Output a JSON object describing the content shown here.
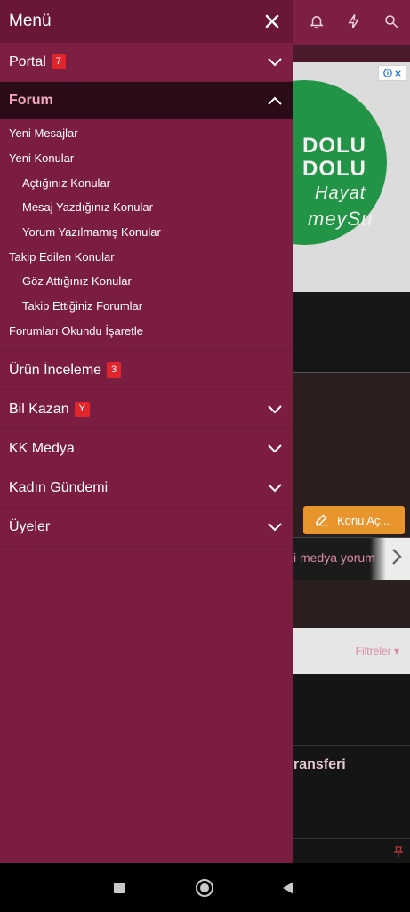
{
  "drawer": {
    "title": "Menü",
    "items": [
      {
        "label": "Portal",
        "badge": "7",
        "expanded": false
      },
      {
        "label": "Forum",
        "badge": "",
        "expanded": true
      },
      {
        "label": "Ürün İnceleme",
        "badge": "3"
      },
      {
        "label": "Bil Kazan",
        "badge": "Y",
        "expanded": false
      },
      {
        "label": "KK Medya",
        "expanded": false
      },
      {
        "label": "Kadın Gündemi",
        "expanded": false
      },
      {
        "label": "Üyeler",
        "expanded": false
      }
    ],
    "forum_sub": [
      {
        "label": "Yeni Mesajlar"
      },
      {
        "label": "Yeni Konular"
      },
      {
        "label": "Açtığınız Konular"
      },
      {
        "label": "Mesaj Yazdığınız Konular"
      },
      {
        "label": "Yorum Yazılmamış Konular"
      },
      {
        "label": "Takip Edilen Konular"
      },
      {
        "label": "Göz Attığınız Konular"
      },
      {
        "label": "Takip Ettiğiniz Forumlar"
      },
      {
        "label": "Forumları Okundu İşaretle"
      }
    ]
  },
  "background": {
    "ad": {
      "line1": "DOLU",
      "line2": "DOLU",
      "line3": "Hayat",
      "line4": "meySu"
    },
    "konu_button": "Konu Aç...",
    "medya_text": "i medya yorum",
    "filter_label": "Filtreler",
    "transfer_text": "ransferi"
  },
  "colors": {
    "drawer_bg": "#7a1d40",
    "drawer_header": "#6a1636",
    "forum_active_bg": "#2a0c18",
    "forum_active_text": "#f4a6c2",
    "badge": "#e0252b",
    "accent_orange": "#e8952e"
  }
}
